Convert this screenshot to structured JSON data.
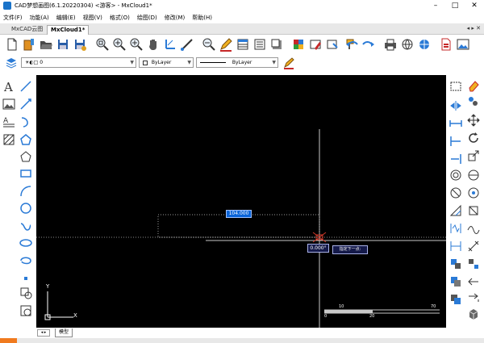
{
  "window": {
    "title": "CAD梦想画图(6.1.20220304) <游客> - MxCloud1*"
  },
  "window_controls": {
    "minimize": "–",
    "maximize": "□",
    "close": "✕"
  },
  "menu": [
    "文件(F)",
    "功能(A)",
    "编辑(E)",
    "视图(V)",
    "格式(O)",
    "绘图(D)",
    "修改(M)",
    "帮助(H)"
  ],
  "tabs": {
    "items": [
      "MxCAD云图",
      "MxCloud1*"
    ],
    "right_controls": "◂ ▸ ✕"
  },
  "layer_bar": {
    "layer": "0",
    "color": "ByLayer",
    "linetype": "ByLayer"
  },
  "canvas": {
    "dimension_value": "104.000",
    "angle_value": "0.000°",
    "prompt": "指定下一点:",
    "ucs": {
      "x": "X",
      "y": "Y"
    },
    "scale": {
      "top_left": "10",
      "top_right": "70",
      "bottom_left": "0",
      "bottom_mid": "20"
    }
  },
  "layout_tabs": {
    "nav": "◂ ▸",
    "model": "模型"
  },
  "status": {
    "progress": 0.035
  },
  "colors": {
    "canvas": "#000000",
    "accent": "#0a64d8",
    "progress": "#f07a1e"
  }
}
